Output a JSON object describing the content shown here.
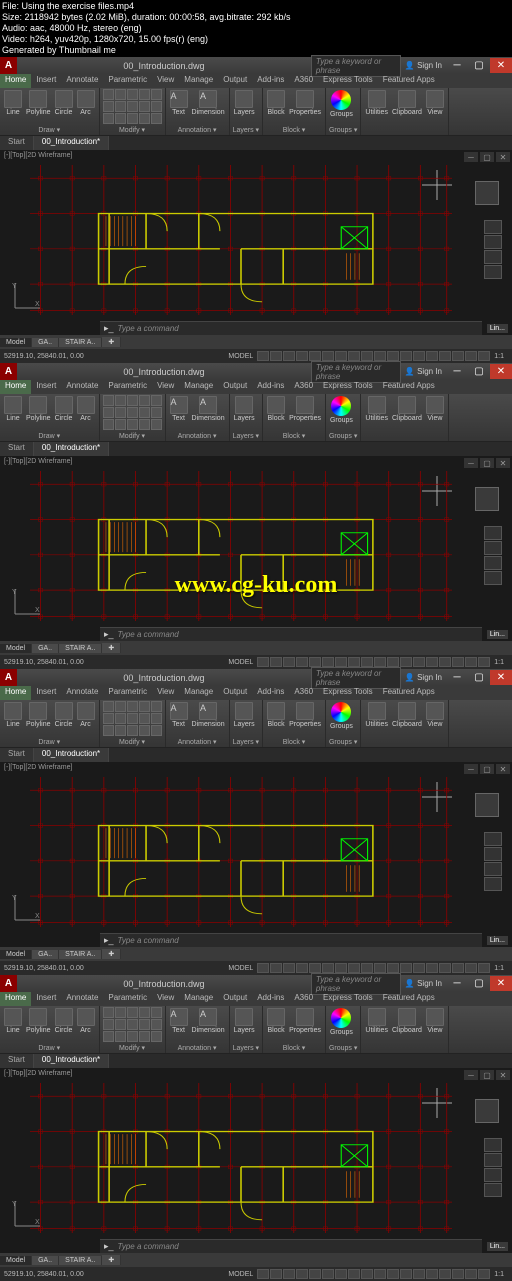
{
  "meta": {
    "line1": "File: Using the exercise files.mp4",
    "line2": "Size: 2118942 bytes (2.02 MiB), duration: 00:00:58, avg.bitrate: 292 kb/s",
    "line3": "Audio: aac, 48000 Hz, stereo (eng)",
    "line4": "Video: h264, yuv420p, 1280x720, 15.00 fps(r) (eng)",
    "line5": "Generated by Thumbnail me"
  },
  "watermark": "www.cg-ku.com",
  "title": {
    "filename": "00_Introduction.dwg",
    "search_placeholder": "Type a keyword or phrase",
    "signin": "Sign In"
  },
  "tabs": {
    "list": [
      "Home",
      "Insert",
      "Annotate",
      "Parametric",
      "View",
      "Manage",
      "Output",
      "Add-ins",
      "A360",
      "Express Tools",
      "Featured Apps"
    ],
    "active": "Home"
  },
  "ribbon": {
    "draw": {
      "label": "Draw ▾",
      "tools": [
        "Line",
        "Polyline",
        "Circle",
        "Arc"
      ]
    },
    "modify": {
      "label": "Modify ▾"
    },
    "annotation": {
      "label": "Annotation ▾",
      "text": "Text",
      "dimension": "Dimension"
    },
    "layers": {
      "label": "Layers ▾",
      "btn": "Layers"
    },
    "block": {
      "label": "Block ▾",
      "block": "Block",
      "properties": "Properties"
    },
    "groups": {
      "label": "Groups ▾",
      "btn": "Groups"
    },
    "utilities": {
      "label": "—",
      "util": "Utilities",
      "clip": "Clipboard",
      "view": "View"
    }
  },
  "file_tabs": {
    "start": "Start",
    "active": "00_Introduction*"
  },
  "viewport": {
    "label": "[-][Top][2D Wireframe]",
    "cmd_placeholder": "Type a command"
  },
  "cmd": {
    "prompt": "▸_"
  },
  "model_tabs": {
    "model": "Model",
    "l1": "GA..",
    "l2": "STAIR A..",
    "plus": "✚"
  },
  "status": {
    "coords": "52919.10, 25840.01, 0.00",
    "model": "MODEL",
    "scale": "1:1"
  },
  "logo": "Lin..."
}
